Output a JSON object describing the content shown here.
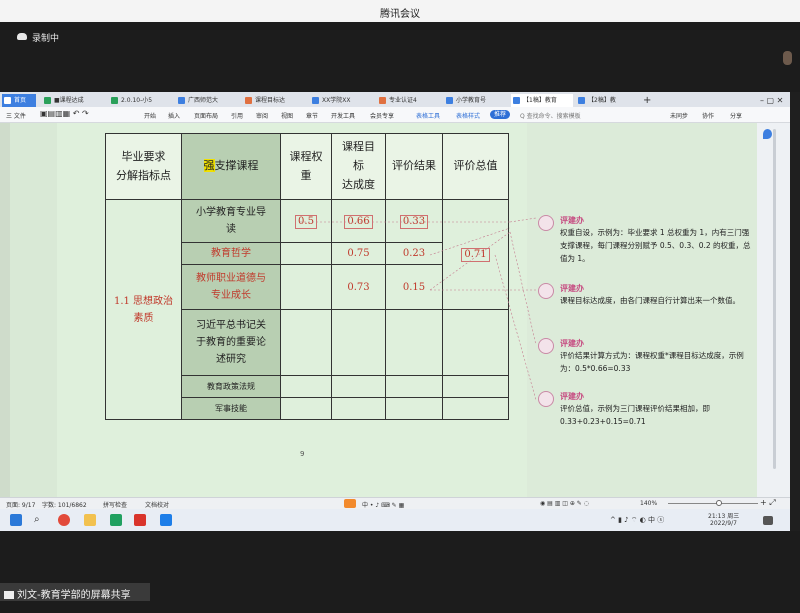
{
  "meeting": {
    "title": "腾讯会议",
    "recording": "录制中",
    "share_label": "刘文-教育学部的屏幕共享"
  },
  "tabs": [
    {
      "label": "首页"
    },
    {
      "label": "■课程达成"
    },
    {
      "label": "2.0.10-小5"
    },
    {
      "label": "广西师范大"
    },
    {
      "label": "课程目标达"
    },
    {
      "label": "XX学院XX"
    },
    {
      "label": "专业认证4"
    },
    {
      "label": "小学教育号"
    },
    {
      "label": "【1稿】教育"
    },
    {
      "label": "【2稿】教"
    }
  ],
  "ribbon": {
    "file": "三 文件",
    "items": [
      "开始",
      "插入",
      "页面布局",
      "引用",
      "审阅",
      "视图",
      "章节",
      "开发工具",
      "会员专享"
    ],
    "table_tools": "表格工具",
    "table_style": "表格样式",
    "recommend": "推荐",
    "search": "Q 查找命令、搜索模板",
    "unsynced": "未同步",
    "collab": "协作",
    "share": "分享"
  },
  "table": {
    "headers": [
      "毕业要求分解指标点",
      "强支撑课程",
      "课程权重",
      "课程目标达成度",
      "评价结果",
      "评价总值"
    ],
    "header_lines": {
      "col1": [
        "毕业要求",
        "分解指标点"
      ],
      "col2_highlight": "强",
      "col2_rest": "支撑课程",
      "col3": [
        "课程权",
        "重"
      ],
      "col4": [
        "课程目",
        "标",
        "达成度"
      ],
      "col5": "评价结果",
      "col6": "评价总值"
    },
    "indicator": [
      "1.1 思想政治",
      "素质"
    ],
    "rows": [
      {
        "course": [
          "小学教育专业导",
          "读"
        ],
        "weight": "0.5",
        "achievement": "0.66",
        "result": "0.33"
      },
      {
        "course": [
          "教育哲学"
        ],
        "weight": "",
        "achievement": "0.75",
        "result": "0.23"
      },
      {
        "course": [
          "教师职业道德与",
          "专业成长"
        ],
        "weight": "",
        "achievement": "0.73",
        "result": "0.15"
      },
      {
        "course": [
          "习近平总书记关",
          "于教育的重要论",
          "述研究"
        ],
        "weight": "",
        "achievement": "",
        "result": ""
      },
      {
        "course": [
          "教育政策法规"
        ],
        "weight": "",
        "achievement": "",
        "result": ""
      },
      {
        "course": [
          "军事技能"
        ],
        "weight": "",
        "achievement": "",
        "result": ""
      }
    ],
    "total": "0.71"
  },
  "page_number": "9",
  "comments": [
    {
      "author": "评建办",
      "text": "权重自设，示例为：毕业要求 1 总权重为 1，内有三门强支撑课程，每门课程分别赋予 0.5、0.3、0.2 的权重，总值为 1。"
    },
    {
      "author": "评建办",
      "text": "课程目标达成度，由各门课程自行计算出来一个数值。"
    },
    {
      "author": "评建办",
      "text": "评价结果计算方式为：课程权重*课程目标达成度，示例为：0.5*0.66=0.33"
    },
    {
      "author": "评建办",
      "text": "评价总值，示例为三门课程评价结果相加，即 0.33+0.23+0.15=0.71"
    }
  ],
  "status": {
    "page": "页面: 9/17",
    "words": "字数: 101/6862",
    "spell": "拼写检查",
    "proof": "文档校对",
    "zoom": "140%"
  },
  "taskbar": {
    "time": "21:13 周三",
    "date": "2022/9/7"
  },
  "colors": {
    "doc_bg": "#dff0dc",
    "comment_author": "#c64a80",
    "highlight": "#f0e000",
    "tab_active": "#3d7fe0"
  }
}
